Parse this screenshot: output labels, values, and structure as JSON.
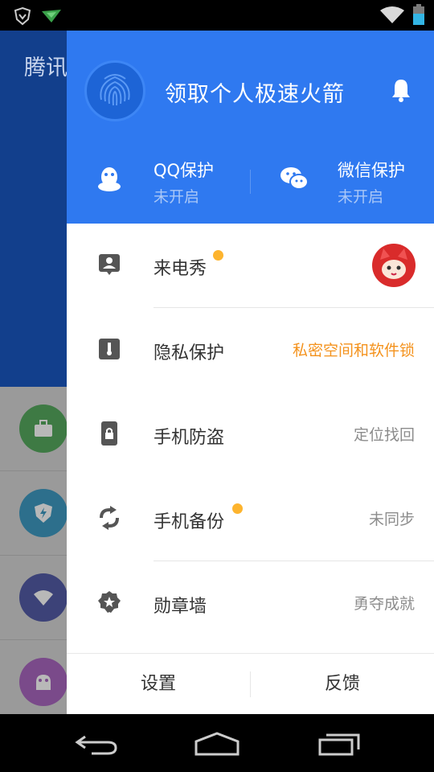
{
  "background_app": {
    "title": "腾讯"
  },
  "drawer": {
    "header_title": "领取个人极速火箭",
    "qq": {
      "title": "QQ保护",
      "status": "未开启"
    },
    "wechat": {
      "title": "微信保护",
      "status": "未开启"
    },
    "menu": [
      {
        "label": "来电秀",
        "value": ""
      },
      {
        "label": "隐私保护",
        "value": "私密空间和软件锁"
      },
      {
        "label": "手机防盗",
        "value": "定位找回"
      },
      {
        "label": "手机备份",
        "value": "未同步"
      },
      {
        "label": "勋章墙",
        "value": "勇夺成就"
      }
    ],
    "footer": {
      "settings": "设置",
      "feedback": "反馈"
    }
  },
  "colors": {
    "drawer_header": "#2f79f0",
    "accent_orange": "#f4921c",
    "badge_dot": "#fdb42e"
  }
}
